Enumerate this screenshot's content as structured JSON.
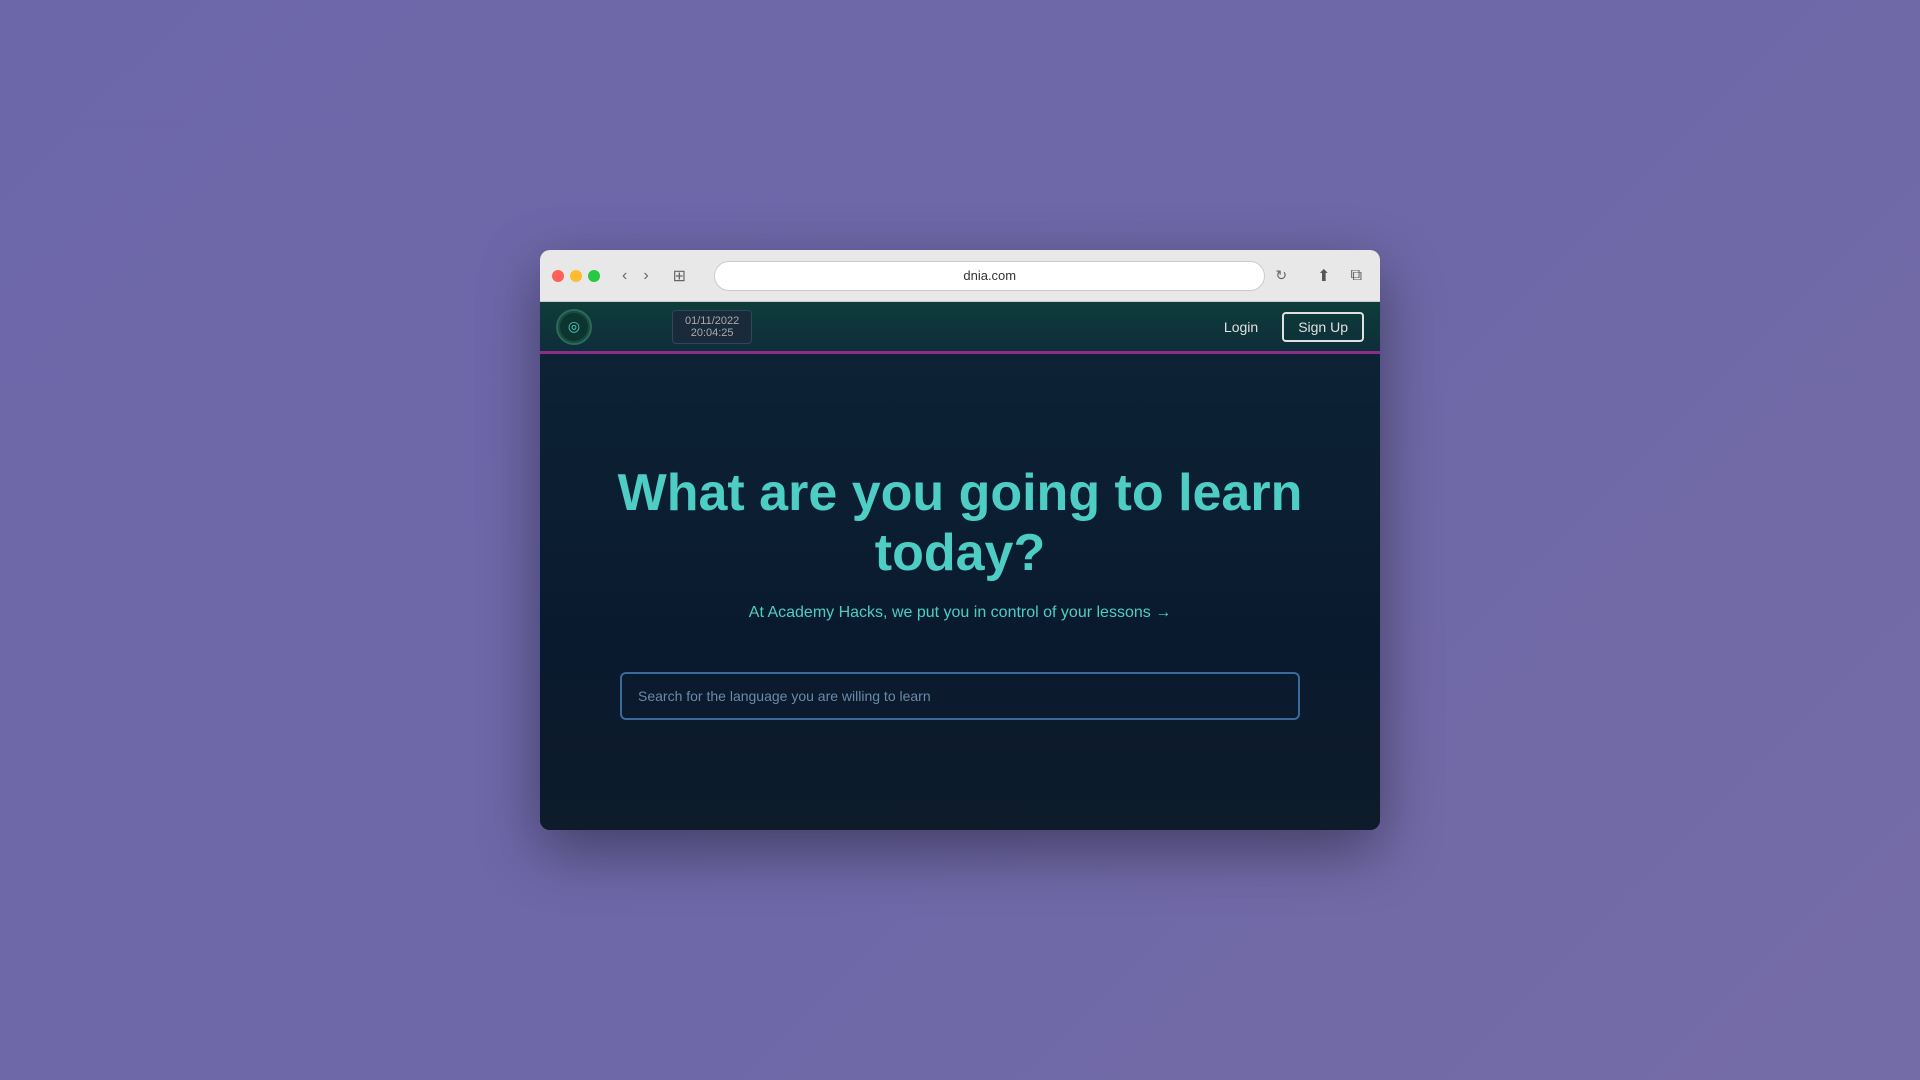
{
  "browser": {
    "url": "dnia.com",
    "traffic_lights": [
      "close",
      "minimize",
      "maximize"
    ]
  },
  "nav": {
    "logo_icon": "◎",
    "datetime": {
      "date": "01/11/2022",
      "time": "20:04:25"
    },
    "login_label": "Login",
    "signup_label": "Sign Up"
  },
  "hero": {
    "title": "What are you going to learn today?",
    "subtitle": "At Academy Hacks, we put you in control of your lessons →",
    "search_placeholder": "Search for the language you are willing to learn"
  }
}
